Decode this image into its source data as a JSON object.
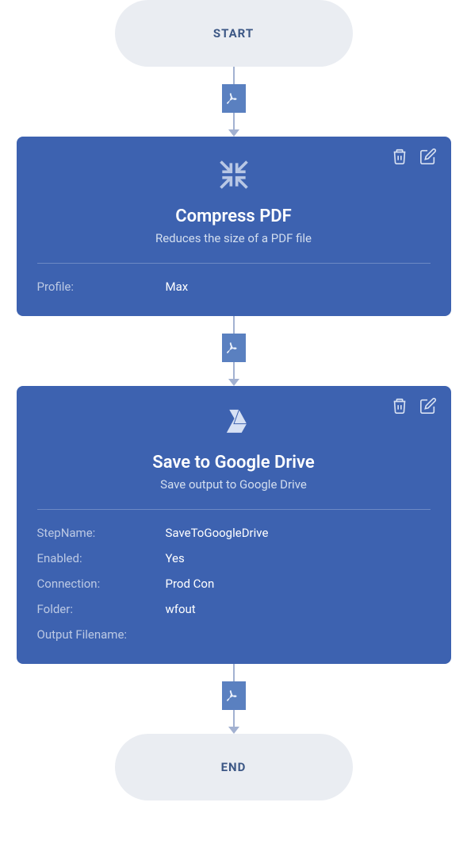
{
  "terminals": {
    "start": "START",
    "end": "END"
  },
  "badge": {
    "icon_name": "pdf-icon"
  },
  "steps": [
    {
      "id": "compress",
      "icon": "compress-icon",
      "title": "Compress PDF",
      "subtitle": "Reduces the size of a PDF file",
      "props": [
        {
          "label": "Profile:",
          "value": "Max"
        }
      ]
    },
    {
      "id": "gdrive",
      "icon": "gdrive-icon",
      "title": "Save to Google Drive",
      "subtitle": "Save output to Google Drive",
      "props": [
        {
          "label": "StepName:",
          "value": "SaveToGoogleDrive"
        },
        {
          "label": "Enabled:",
          "value": "Yes"
        },
        {
          "label": "Connection:",
          "value": "Prod Con"
        },
        {
          "label": "Folder:",
          "value": "wfout"
        },
        {
          "label": "Output Filename:",
          "value": ""
        }
      ]
    }
  ]
}
